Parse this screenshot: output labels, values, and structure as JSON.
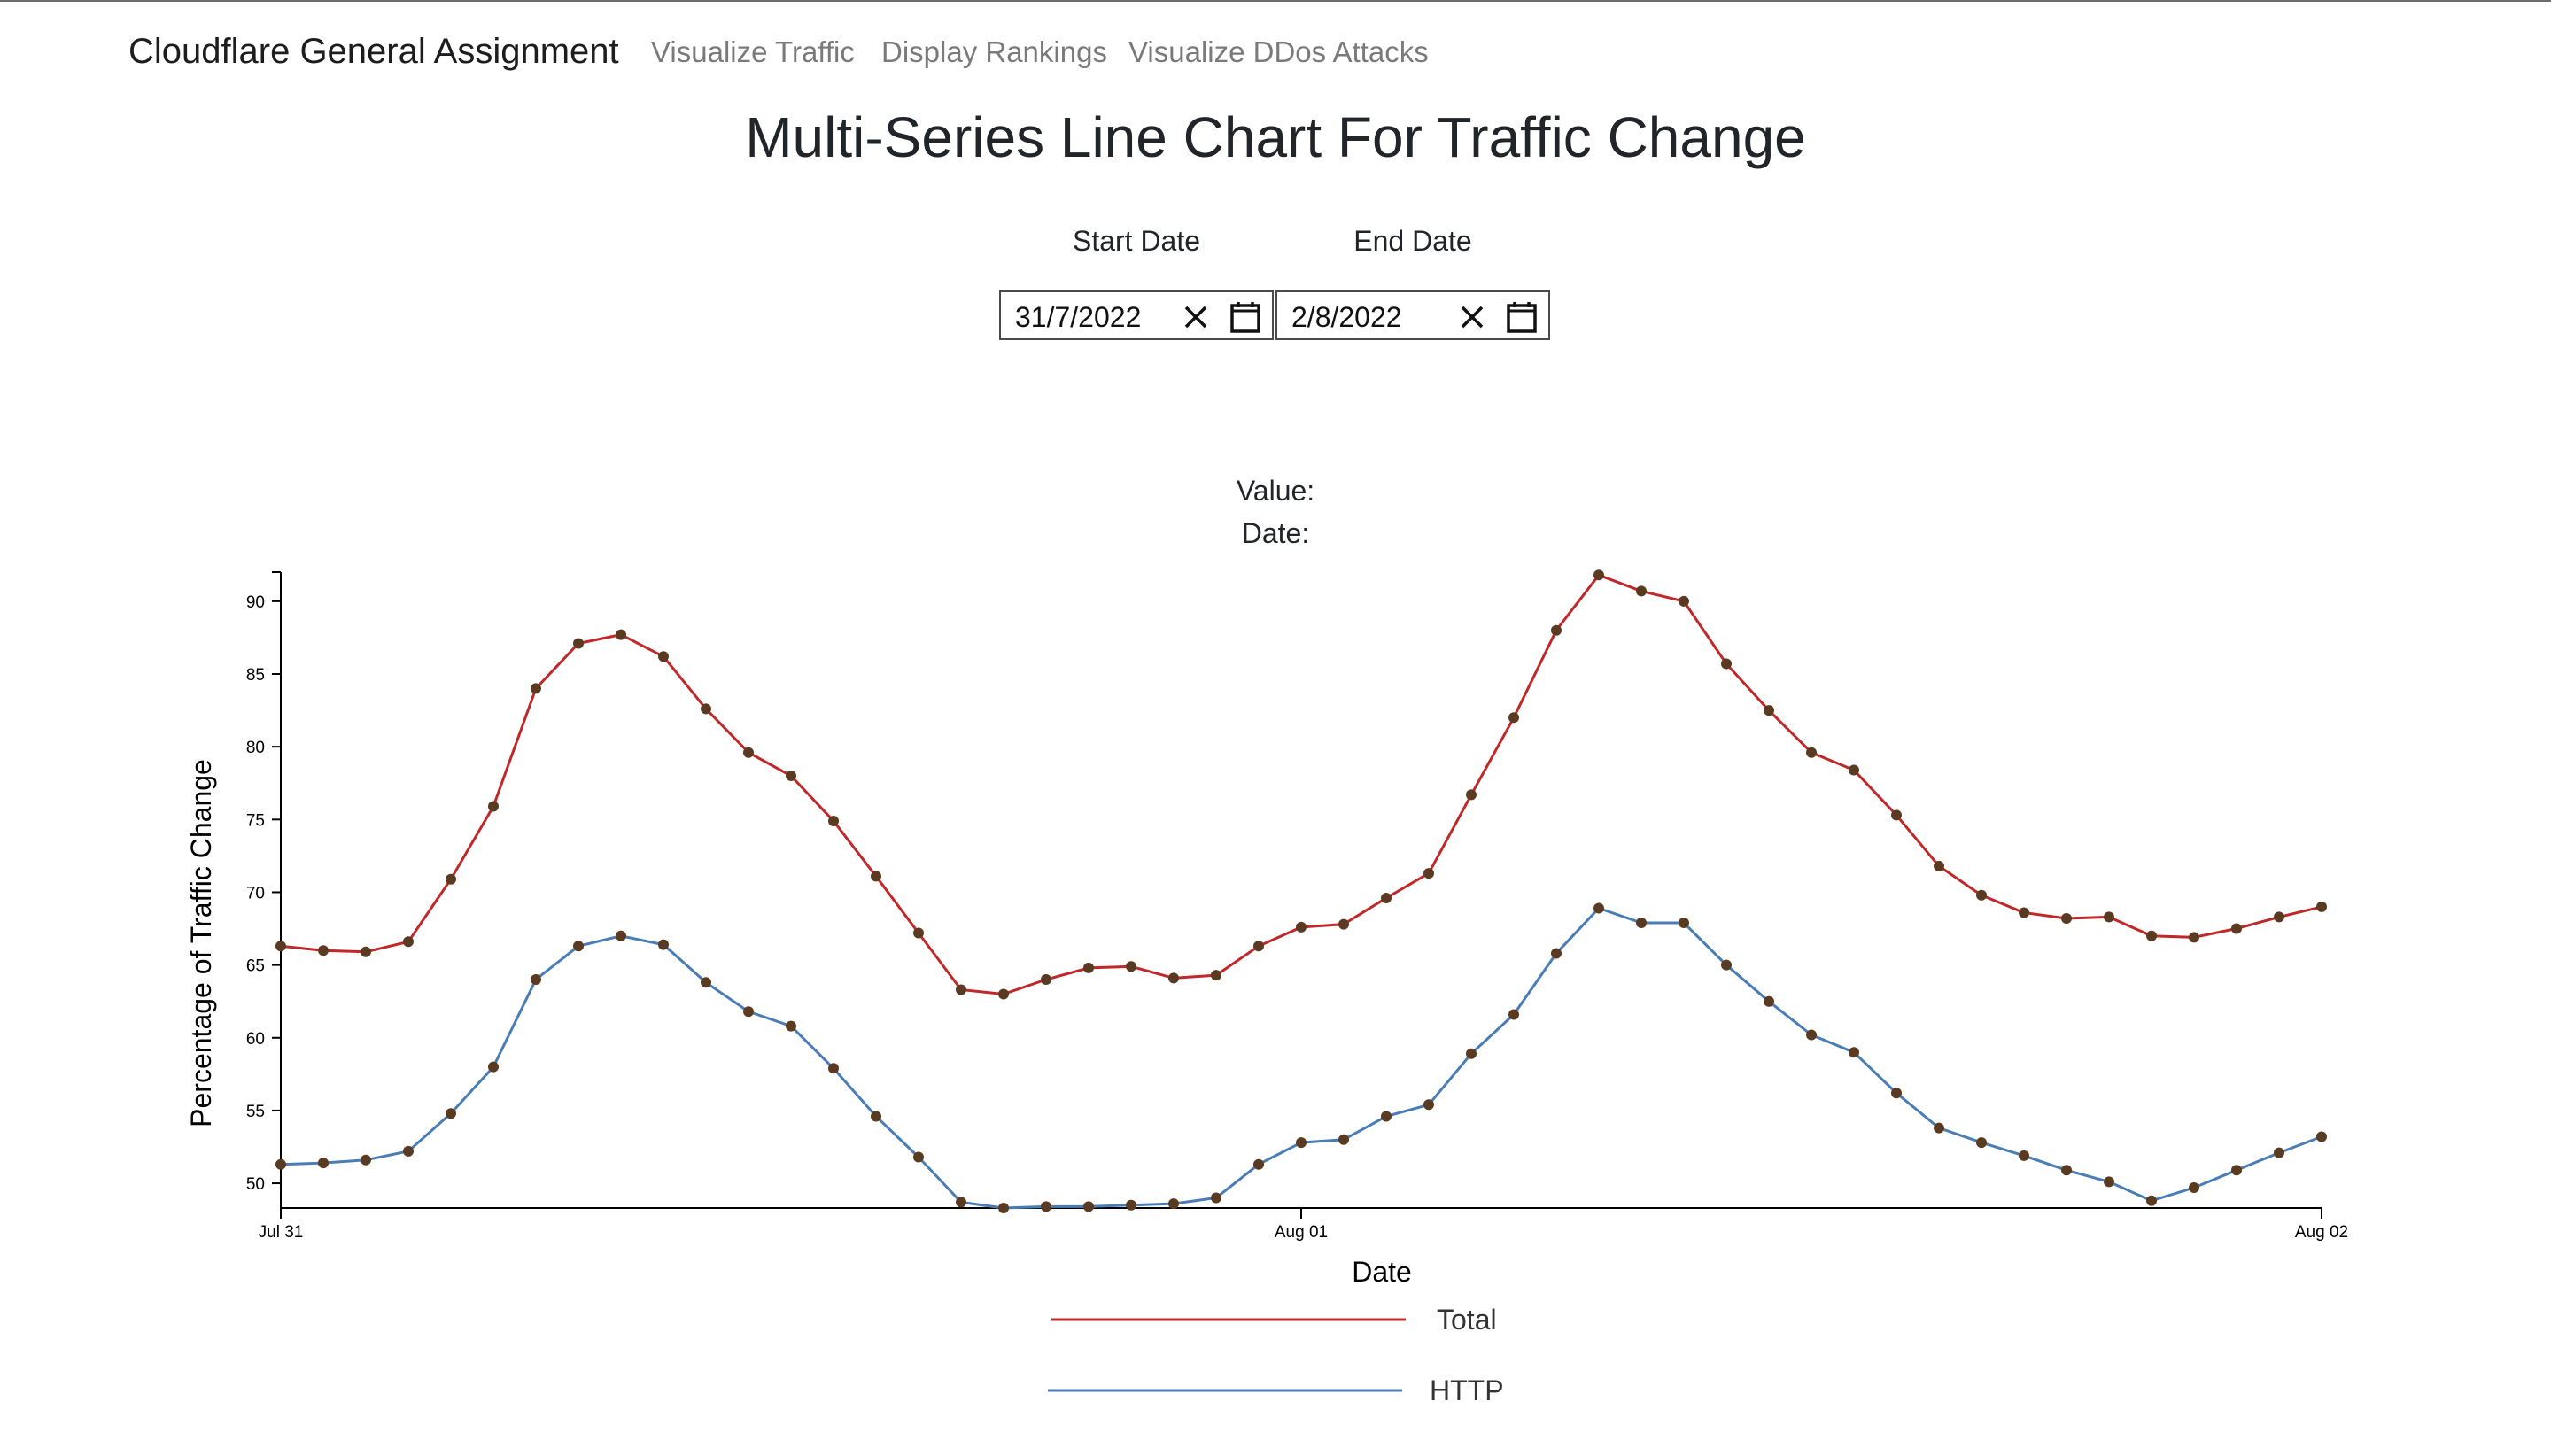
{
  "nav": {
    "brand": "Cloudflare General Assignment",
    "links": [
      "Visualize Traffic",
      "Display Rankings",
      "Visualize DDos Attacks"
    ]
  },
  "page": {
    "title": "Multi-Series Line Chart For Traffic Change"
  },
  "filters": {
    "start_label": "Start Date",
    "start_value": "31/7/2022",
    "end_label": "End Date",
    "end_value": "2/8/2022"
  },
  "tooltip": {
    "value_label": "Value:",
    "date_label": "Date:"
  },
  "colors": {
    "total": "#c0282a",
    "http": "#4a7db5",
    "point": "#5a3b22"
  },
  "chart_data": {
    "type": "line",
    "title": "",
    "xlabel": "Date",
    "ylabel": "Percentage of Traffic Change",
    "x_ticks": [
      "Jul 31",
      "Aug 01",
      "Aug 02"
    ],
    "y_ticks": [
      50,
      55,
      60,
      65,
      70,
      75,
      80,
      85,
      90
    ],
    "ylim": [
      48.3,
      92
    ],
    "xlim": [
      "2022-07-31T00:00",
      "2022-08-02T00:00"
    ],
    "x_interval_hours": 1,
    "grid": false,
    "legend": "bottom-center",
    "series": [
      {
        "name": "Total",
        "color": "#c0282a",
        "values": [
          66.3,
          66.0,
          65.9,
          66.6,
          70.9,
          75.9,
          84.0,
          87.1,
          87.7,
          86.2,
          82.6,
          79.6,
          78.0,
          74.9,
          71.1,
          67.2,
          63.3,
          63.0,
          64.0,
          64.8,
          64.9,
          64.1,
          64.3,
          66.3,
          67.6,
          67.8,
          69.6,
          71.3,
          76.7,
          82.0,
          88.0,
          91.8,
          90.7,
          90.0,
          85.7,
          82.5,
          79.6,
          78.4,
          75.3,
          71.8,
          69.8,
          68.6,
          68.2,
          68.3,
          67.0,
          66.9,
          67.5,
          68.3,
          69.0
        ],
        "x": [
          0,
          1,
          2,
          3,
          4,
          5,
          6,
          7,
          8,
          9,
          10,
          11,
          12,
          13,
          14,
          15,
          16,
          17,
          18,
          19,
          20,
          21,
          22,
          23,
          24,
          25,
          26,
          27,
          28,
          29,
          30,
          31,
          32,
          33,
          34,
          35,
          36,
          37,
          38,
          39,
          40,
          41,
          42,
          43,
          44,
          45,
          46,
          47,
          48
        ]
      },
      {
        "name": "HTTP",
        "color": "#4a7db5",
        "values": [
          51.3,
          51.4,
          51.6,
          52.2,
          54.8,
          58.0,
          64.0,
          66.3,
          67.0,
          66.4,
          63.8,
          61.8,
          60.8,
          57.9,
          54.6,
          51.8,
          48.7,
          48.3,
          48.4,
          48.4,
          48.5,
          48.6,
          49.0,
          51.3,
          52.8,
          53.0,
          54.6,
          55.4,
          58.9,
          61.6,
          65.8,
          68.9,
          67.9,
          67.9,
          65.0,
          62.5,
          60.2,
          59.0,
          56.2,
          53.8,
          52.8,
          51.9,
          50.9,
          50.1,
          48.8,
          49.7,
          50.9,
          52.1,
          53.2
        ],
        "x": [
          0,
          1,
          2,
          3,
          4,
          5,
          6,
          7,
          8,
          9,
          10,
          11,
          12,
          13,
          14,
          15,
          16,
          17,
          18,
          19,
          20,
          21,
          22,
          23,
          24,
          25,
          26,
          27,
          28,
          29,
          30,
          31,
          32,
          33,
          34,
          35,
          36,
          37,
          38,
          39,
          40,
          41,
          42,
          43,
          44,
          45,
          46,
          47,
          48
        ]
      }
    ]
  }
}
